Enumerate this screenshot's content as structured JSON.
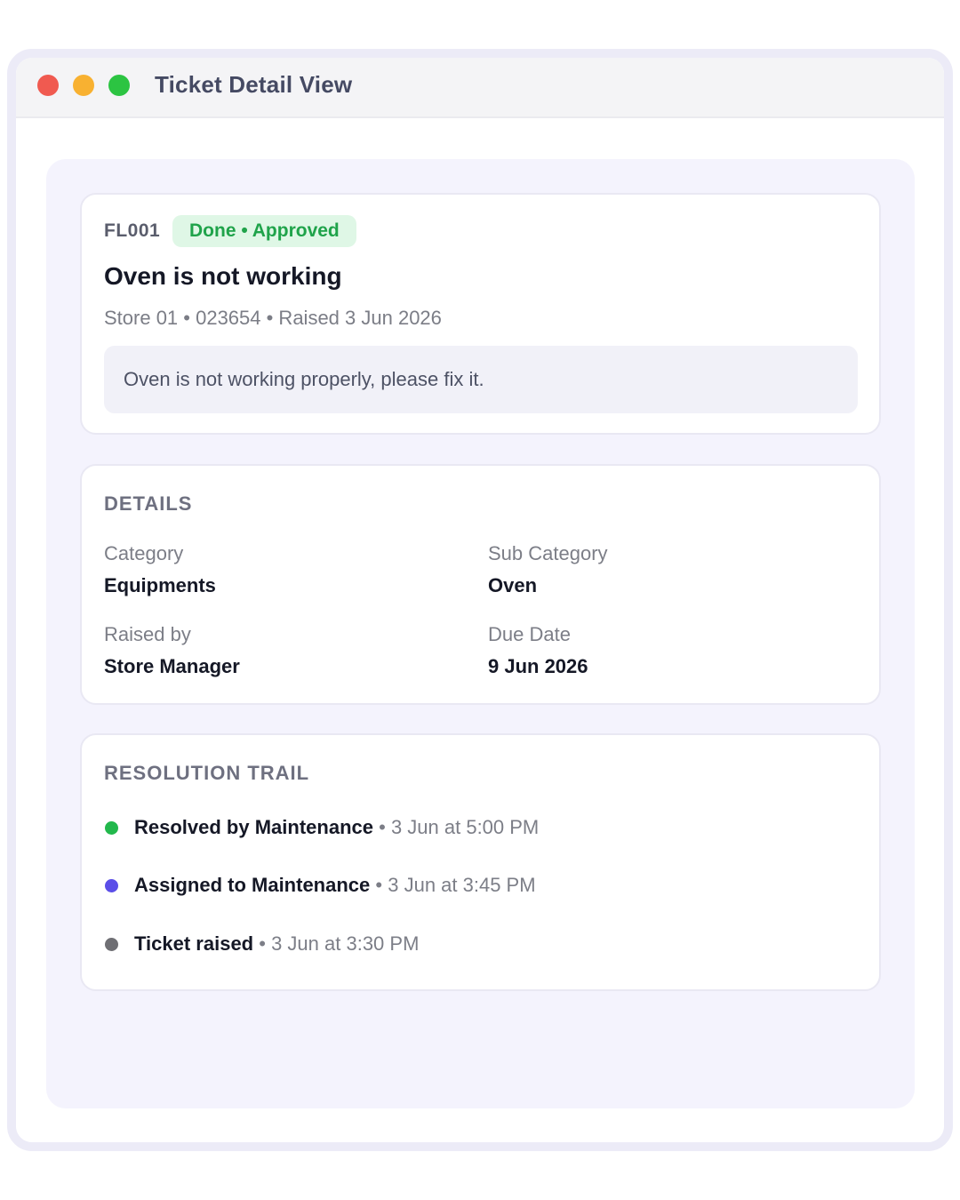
{
  "window": {
    "title": "Ticket Detail View"
  },
  "ticket": {
    "id": "FL001",
    "status": "Done • Approved",
    "title": "Oven is not working",
    "meta": "Store 01 • 023654 • Raised 3 Jun 2026",
    "description": "Oven is not working properly, please fix it."
  },
  "details": {
    "heading": "DETAILS",
    "fields": [
      {
        "label": "Category",
        "value": "Equipments"
      },
      {
        "label": "Sub Category",
        "value": "Oven"
      },
      {
        "label": "Raised by",
        "value": "Store Manager"
      },
      {
        "label": "Due Date",
        "value": "9 Jun 2026"
      }
    ]
  },
  "trail": {
    "heading": "RESOLUTION TRAIL",
    "separator": "•",
    "events": [
      {
        "action": "Resolved by Maintenance",
        "time": "3 Jun at 5:00 PM",
        "color": "#22b84c"
      },
      {
        "action": "Assigned to Maintenance",
        "time": "3 Jun at 3:45 PM",
        "color": "#5b4ee8"
      },
      {
        "action": "Ticket raised",
        "time": "3 Jun at 3:30 PM",
        "color": "#6f6f74"
      }
    ]
  },
  "colors": {
    "status_green": "#1fa34a",
    "status_bg": "#dff7e6",
    "canvas_bg": "#f4f3fd"
  }
}
